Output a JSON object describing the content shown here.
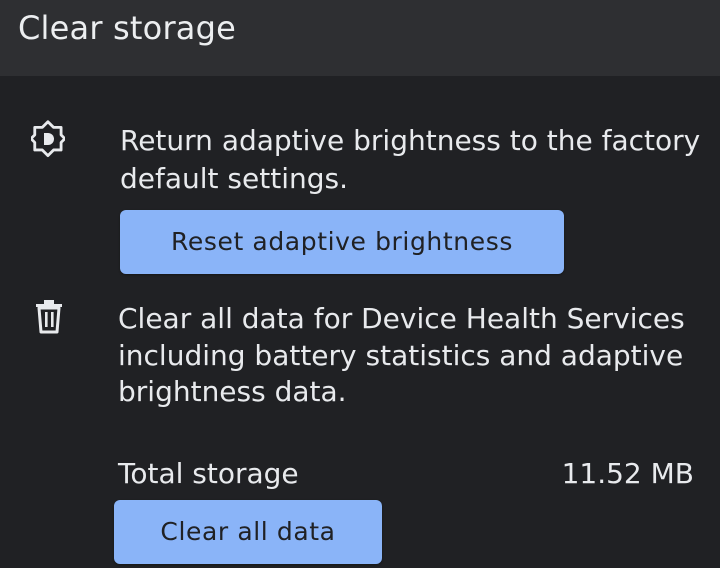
{
  "app_bar": {
    "title": "Clear storage"
  },
  "brightness_section": {
    "icon": "brightness-auto-icon",
    "description_line1": "Return adaptive brightness to the factory",
    "description_line2": "default settings.",
    "button_label": "Reset adaptive brightness"
  },
  "clear_data_section": {
    "icon": "trash-icon",
    "description_line1": "Clear all data for Device Health Services",
    "description_line2": "including battery statistics and adaptive",
    "description_line3": "brightness data."
  },
  "storage": {
    "label": "Total storage",
    "value": "11.52 MB",
    "button_label": "Clear all data"
  },
  "colors": {
    "background": "#202124",
    "app_bar": "#2e2f32",
    "button": "#8ab4f8",
    "text": "#e8eaed"
  }
}
